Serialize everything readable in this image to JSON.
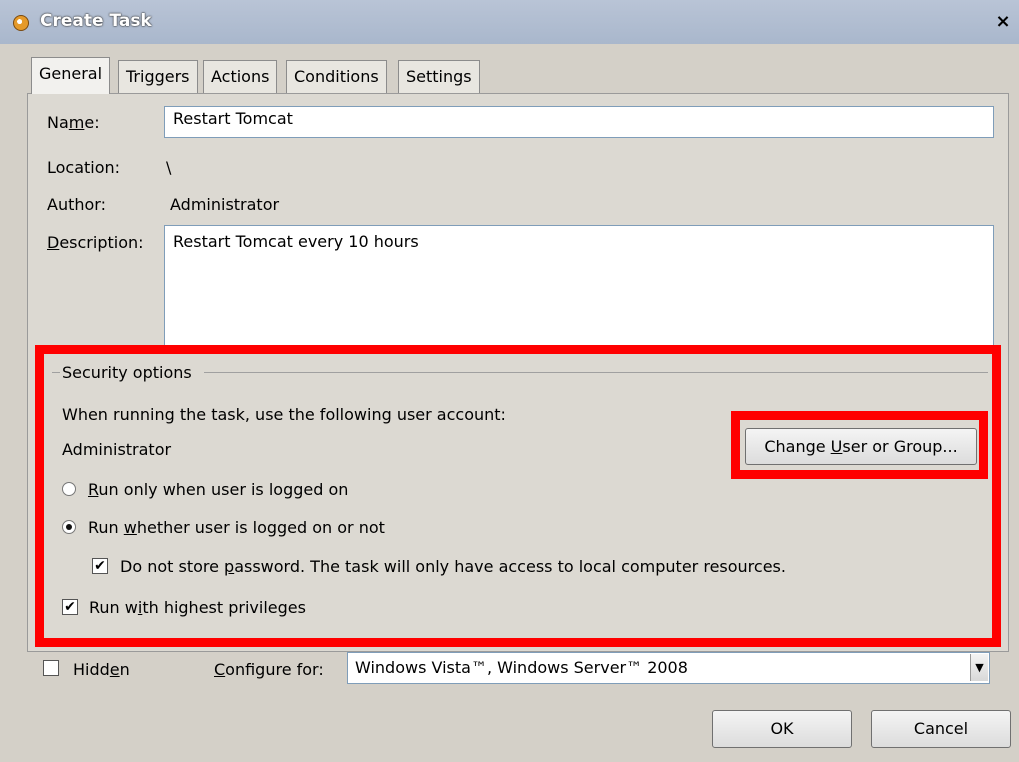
{
  "window": {
    "title": "Create Task",
    "close_glyph": "×"
  },
  "tabs": [
    {
      "label": "General",
      "active": true
    },
    {
      "label": "Triggers"
    },
    {
      "label": "Actions"
    },
    {
      "label": "Conditions"
    },
    {
      "label": "Settings"
    }
  ],
  "general": {
    "name_label_pre": "Na",
    "name_label_ul": "m",
    "name_label_post": "e:",
    "name_value": "Restart Tomcat",
    "location_label": "Location:",
    "location_value": "\\",
    "author_label": "Author:",
    "author_value": "Administrator",
    "description_label_ul": "D",
    "description_label_post": "escription:",
    "description_value": "Restart Tomcat every 10 hours"
  },
  "security": {
    "group_title": "Security options",
    "account_prompt": "When running the task, use the following user account:",
    "account_value": "Administrator",
    "change_button_pre": "Change ",
    "change_button_ul": "U",
    "change_button_post": "ser or Group...",
    "radio_logged_on_ul": "R",
    "radio_logged_on_post": "un only when user is logged on",
    "radio_logged_on_selected": false,
    "radio_whether_pre": "Run ",
    "radio_whether_ul": "w",
    "radio_whether_post": "hether user is logged on or not",
    "radio_whether_selected": true,
    "no_store_pre": "Do not store ",
    "no_store_ul": "p",
    "no_store_post": "assword.  The task will only have access to local computer resources.",
    "no_store_checked": true,
    "highest_pre": "Run w",
    "highest_ul": "i",
    "highest_post": "th highest privileges",
    "highest_checked": true,
    "highlight_color": "#ff0000"
  },
  "footer": {
    "hidden_pre": "Hidd",
    "hidden_ul": "e",
    "hidden_post": "n",
    "hidden_checked": false,
    "configure_ul": "C",
    "configure_post": "onfigure for:",
    "configure_value": "Windows Vista™, Windows Server™ 2008",
    "ok_label": "OK",
    "cancel_label": "Cancel"
  }
}
